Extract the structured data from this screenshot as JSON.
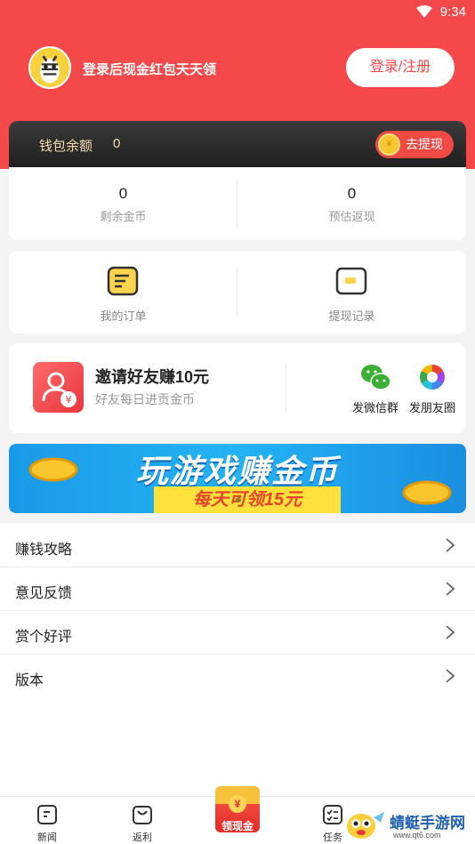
{
  "status_bar": {
    "time": "9:34",
    "wifi_icon": "wifi-icon"
  },
  "profile": {
    "avatar_icon": "zebra-avatar",
    "login_hint": "登录后现金红包天天领",
    "login_button": "登录/注册"
  },
  "wallet": {
    "label": "钱包余额",
    "value": "0",
    "withdraw_button": "去提现",
    "coin_symbol": "¥"
  },
  "stats": [
    {
      "value": "0",
      "label": "剩余金币"
    },
    {
      "value": "0",
      "label": "预估返现"
    }
  ],
  "orders": [
    {
      "label": "我的订单",
      "icon": "order-icon"
    },
    {
      "label": "提现记录",
      "icon": "wallet-card-icon"
    }
  ],
  "invite": {
    "title": "邀请好友赚10元",
    "subtitle": "好友每日进贡金币",
    "shares": [
      {
        "label": "发微信群",
        "icon": "wechat-icon"
      },
      {
        "label": "发朋友圈",
        "icon": "moments-icon"
      }
    ]
  },
  "banner": {
    "title": "玩游戏赚金币",
    "subtitle": "每天可领15元"
  },
  "menu": [
    {
      "label": "赚钱攻略"
    },
    {
      "label": "意见反馈"
    },
    {
      "label": "赏个好评"
    },
    {
      "label": "版本"
    }
  ],
  "tabs": [
    {
      "label": "新闻",
      "icon": "news-icon"
    },
    {
      "label": "返利",
      "icon": "shopping-bag-icon"
    },
    {
      "label": "领现金",
      "icon": "red-envelope-icon"
    },
    {
      "label": "任务",
      "icon": "task-list-icon"
    }
  ],
  "watermark": {
    "title": "蜻蜓手游网",
    "url": "www.qt6.com"
  },
  "colors": {
    "primary_red": "#f5484a",
    "wallet_gold": "#f4dcae",
    "banner_blue": "#1a9ae6"
  }
}
